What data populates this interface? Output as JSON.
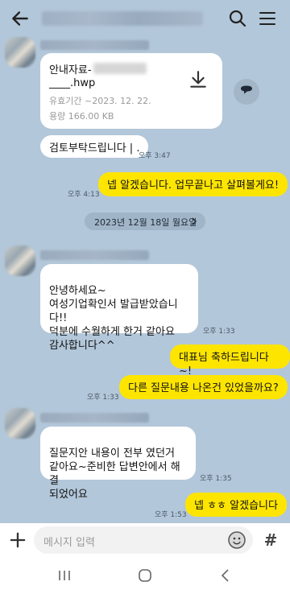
{
  "header": {
    "back_icon": "back-arrow-icon",
    "search_icon": "search-icon",
    "menu_icon": "hamburger-menu-icon"
  },
  "file": {
    "name_line1": "안내자료-",
    "name_line2": "____.hwp",
    "expiry": "유효기간 ~2023. 12. 22.",
    "size": "용량   166.00 KB",
    "download_icon": "download-icon"
  },
  "messages": [
    {
      "text": "검토부탁드립니다 | .",
      "time": "오후 3:47"
    },
    {
      "text": "넵 알겠습니다. 업무끝나고 살펴볼게요!",
      "time": "오후 4:13"
    },
    {
      "text": "안녕하세요~\n여성기업확인서 발급받았습니다!!\n덕분에 수월하게 한거 같아요\n감사합니다^^",
      "time": "오후 1:33"
    },
    {
      "text": "대표님 축하드립니다~!",
      "time": ""
    },
    {
      "text": "다른 질문내용 나온건 있었을까요?",
      "time": "오후 1:33"
    },
    {
      "text": "질문지안 내용이 전부 였던거\n같아요~준비한 답변안에서 해결\n되었어요",
      "time": "오후 1:35"
    },
    {
      "text": "넵 ㅎㅎ 알겠습니다",
      "time": "오후 1:53"
    }
  ],
  "date_divider": "2023년 12월 18일 월요일",
  "input": {
    "placeholder": "메시지 입력",
    "hash": "#"
  },
  "colors": {
    "background": "#b2c7d9",
    "outgoing_bubble": "#fee500",
    "incoming_bubble": "#ffffff"
  }
}
